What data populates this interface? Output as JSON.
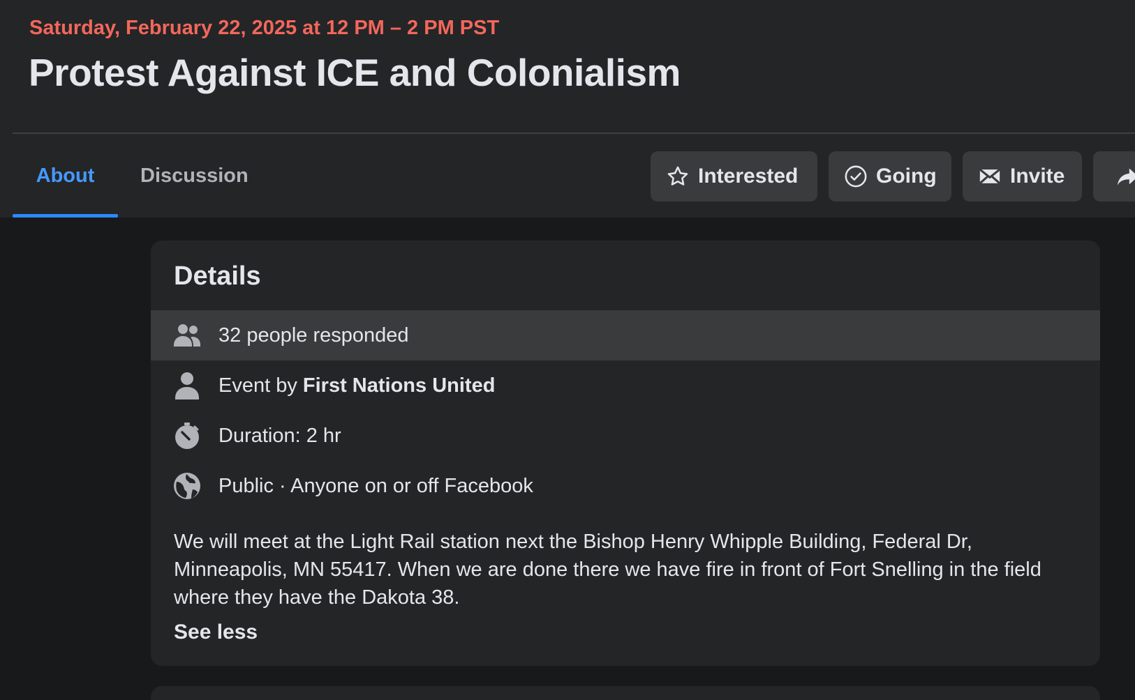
{
  "event": {
    "date": "Saturday, February 22, 2025 at 12 PM – 2 PM PST",
    "title": "Protest Against ICE and Colonialism"
  },
  "tabs": [
    {
      "label": "About",
      "active": true
    },
    {
      "label": "Discussion",
      "active": false
    }
  ],
  "actions": {
    "interested": {
      "label": "Interested",
      "icon": "star-icon"
    },
    "going": {
      "label": "Going",
      "icon": "check-circle-icon"
    },
    "invite": {
      "label": "Invite",
      "icon": "envelope-icon"
    },
    "share": {
      "label": "",
      "icon": "share-arrow-icon"
    }
  },
  "details": {
    "heading": "Details",
    "responded": "32 people responded",
    "event_by_prefix": "Event by ",
    "host": "First Nations United",
    "duration": "Duration: 2 hr",
    "privacy": "Public · Anyone on or off Facebook",
    "description": "We will meet at the Light Rail station next the Bishop Henry Whipple Building, Federal Dr, Minneapolis, MN 55417. When we are done there we have fire in front of Fort Snelling in the field where they have the Dakota 38.",
    "see_less": "See less"
  },
  "colors": {
    "date_accent": "#f3675c",
    "tab_active": "#4599ff",
    "background": "#18191a",
    "card": "#242526",
    "button": "#3a3b3c"
  }
}
